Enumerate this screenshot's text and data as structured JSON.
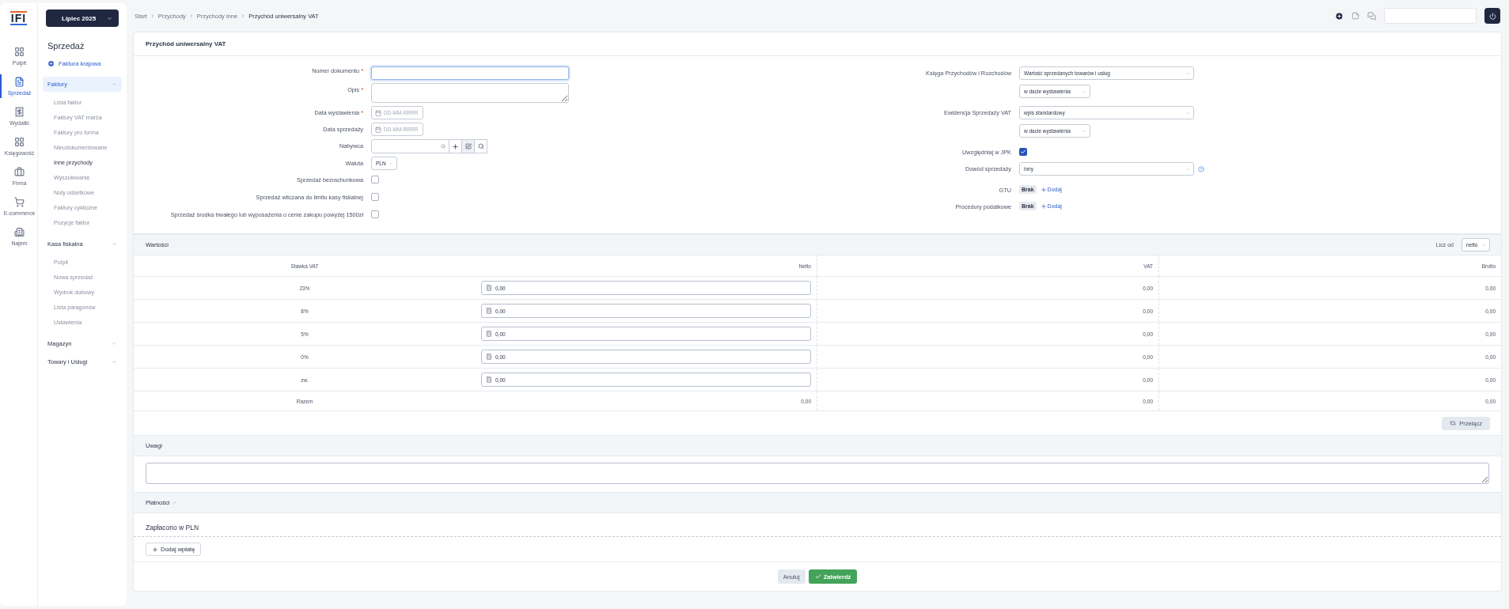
{
  "logo": "IFI",
  "rail": [
    {
      "label": "Pulpit",
      "kind": "dashboard",
      "selected": false
    },
    {
      "label": "Sprzedaż",
      "kind": "sales",
      "selected": true
    },
    {
      "label": "Wydatki",
      "kind": "expenses",
      "selected": false
    },
    {
      "label": "Księgowość",
      "kind": "accounting",
      "selected": false
    },
    {
      "label": "Firma",
      "kind": "company",
      "selected": false
    },
    {
      "label": "E-commerce",
      "kind": "cart",
      "selected": false
    },
    {
      "label": "Najem",
      "kind": "rent",
      "selected": false
    }
  ],
  "month_picker": "Lipiec 2025",
  "sidebar": {
    "title": "Sprzedaż",
    "new_link": "Faktura krajowa",
    "groups": [
      {
        "label": "Faktury",
        "expanded": true,
        "selected": true,
        "items": [
          {
            "label": "Lista faktur",
            "selected": false
          },
          {
            "label": "Faktury VAT marża",
            "selected": false
          },
          {
            "label": "Faktury pro forma",
            "selected": false
          },
          {
            "label": "Nieudokumentowane",
            "selected": false
          },
          {
            "label": "Inne przychody",
            "selected": true
          },
          {
            "label": "Wyszukiwanie",
            "selected": false
          },
          {
            "label": "Noty odsetkowe",
            "selected": false
          },
          {
            "label": "Faktury cykliczne",
            "selected": false
          },
          {
            "label": "Pozycje faktur",
            "selected": false
          }
        ]
      },
      {
        "label": "Kasa fiskalna",
        "expanded": true,
        "selected": false,
        "items": [
          {
            "label": "Pulpit",
            "selected": false
          },
          {
            "label": "Nowa sprzedaż",
            "selected": false
          },
          {
            "label": "Wydruk dobowy",
            "selected": false
          },
          {
            "label": "Lista paragonów",
            "selected": false
          },
          {
            "label": "Ustawienia",
            "selected": false
          }
        ]
      },
      {
        "label": "Magazyn",
        "expanded": false,
        "selected": false
      },
      {
        "label": "Towary i Usługi",
        "expanded": false,
        "selected": false
      }
    ]
  },
  "breadcrumb": [
    "Start",
    "Przychody",
    "Przychody inne",
    "Przychód uniwersalny VAT"
  ],
  "card_title": "Przychód uniwersalny VAT",
  "form_left": [
    {
      "kind": "text",
      "label": "Numer dokumentu",
      "required_mark": "*"
    },
    {
      "kind": "textarea",
      "label": "Opis",
      "required_mark": "*"
    },
    {
      "kind": "date",
      "label": "Data wystawienia",
      "required_mark": "*",
      "placeholder": "DD-MM-RRRR"
    },
    {
      "kind": "date",
      "label": "Data sprzedaży",
      "placeholder": "DD-MM-RRRR"
    },
    {
      "kind": "buyer",
      "label": "Nabywca"
    },
    {
      "kind": "select",
      "label": "Waluta",
      "value": "PLN"
    },
    {
      "kind": "checkbox",
      "label": "Sprzedaż bezrachunkowa",
      "checked": false
    },
    {
      "kind": "checkbox",
      "label": "Sprzedaż wliczana do limitu kasy fiskalnej",
      "checked": false
    },
    {
      "kind": "checkbox",
      "label": "Sprzedaż środka trwałego lub wyposażenia o cenie zakupu powyżej 1500zł",
      "checked": false
    }
  ],
  "form_right": [
    {
      "kind": "selects",
      "label": "Księga Przychodów i Rozchodów",
      "values": [
        "Wartość sprzedanych towarów i usług",
        "w dacie wystawienia"
      ]
    },
    {
      "kind": "selects",
      "label": "Ewidencja Sprzedaży VAT",
      "values": [
        "wpis standardowy",
        "w dacie wystawienia"
      ]
    },
    {
      "kind": "checkbox",
      "label": "Uwzględniaj w JPK",
      "checked": true
    },
    {
      "kind": "selects",
      "label": "Dowód sprzedaży",
      "values": [
        "inny"
      ],
      "help": true
    },
    {
      "kind": "tags",
      "label": "GTU",
      "tag": "Brak",
      "action": "Dodaj"
    },
    {
      "kind": "tags",
      "label": "Procedury podatkowe",
      "tag": "Brak",
      "action": "Dodaj"
    }
  ],
  "values": {
    "title": "Wartości",
    "calc_label": "Licz od",
    "calc_value": "netto",
    "columns": [
      "Stawka VAT",
      "Netto",
      "VAT",
      "Brutto"
    ],
    "rows": [
      {
        "rate": "23%",
        "net": "0,00",
        "vat": "0,00",
        "gross": "0,00"
      },
      {
        "rate": "8%",
        "net": "0,00",
        "vat": "0,00",
        "gross": "0,00"
      },
      {
        "rate": "5%",
        "net": "0,00",
        "vat": "0,00",
        "gross": "0,00"
      },
      {
        "rate": "0%",
        "net": "0,00",
        "vat": "0,00",
        "gross": "0,00"
      },
      {
        "rate": "zw.",
        "net": "0,00",
        "vat": "0,00",
        "gross": "0,00"
      }
    ],
    "total": {
      "label": "Razem",
      "net": "0,00",
      "vat": "0,00",
      "gross": "0,00"
    },
    "switch_button": "Przełącz"
  },
  "notes": {
    "title": "Uwagi"
  },
  "payments": {
    "title": "Płatności",
    "expanded": true,
    "paid_label": "Zapłacono w PLN",
    "add_button": "Dodaj wpłatę"
  },
  "actions": {
    "cancel": "Anuluj",
    "confirm": "Zatwierdź"
  }
}
